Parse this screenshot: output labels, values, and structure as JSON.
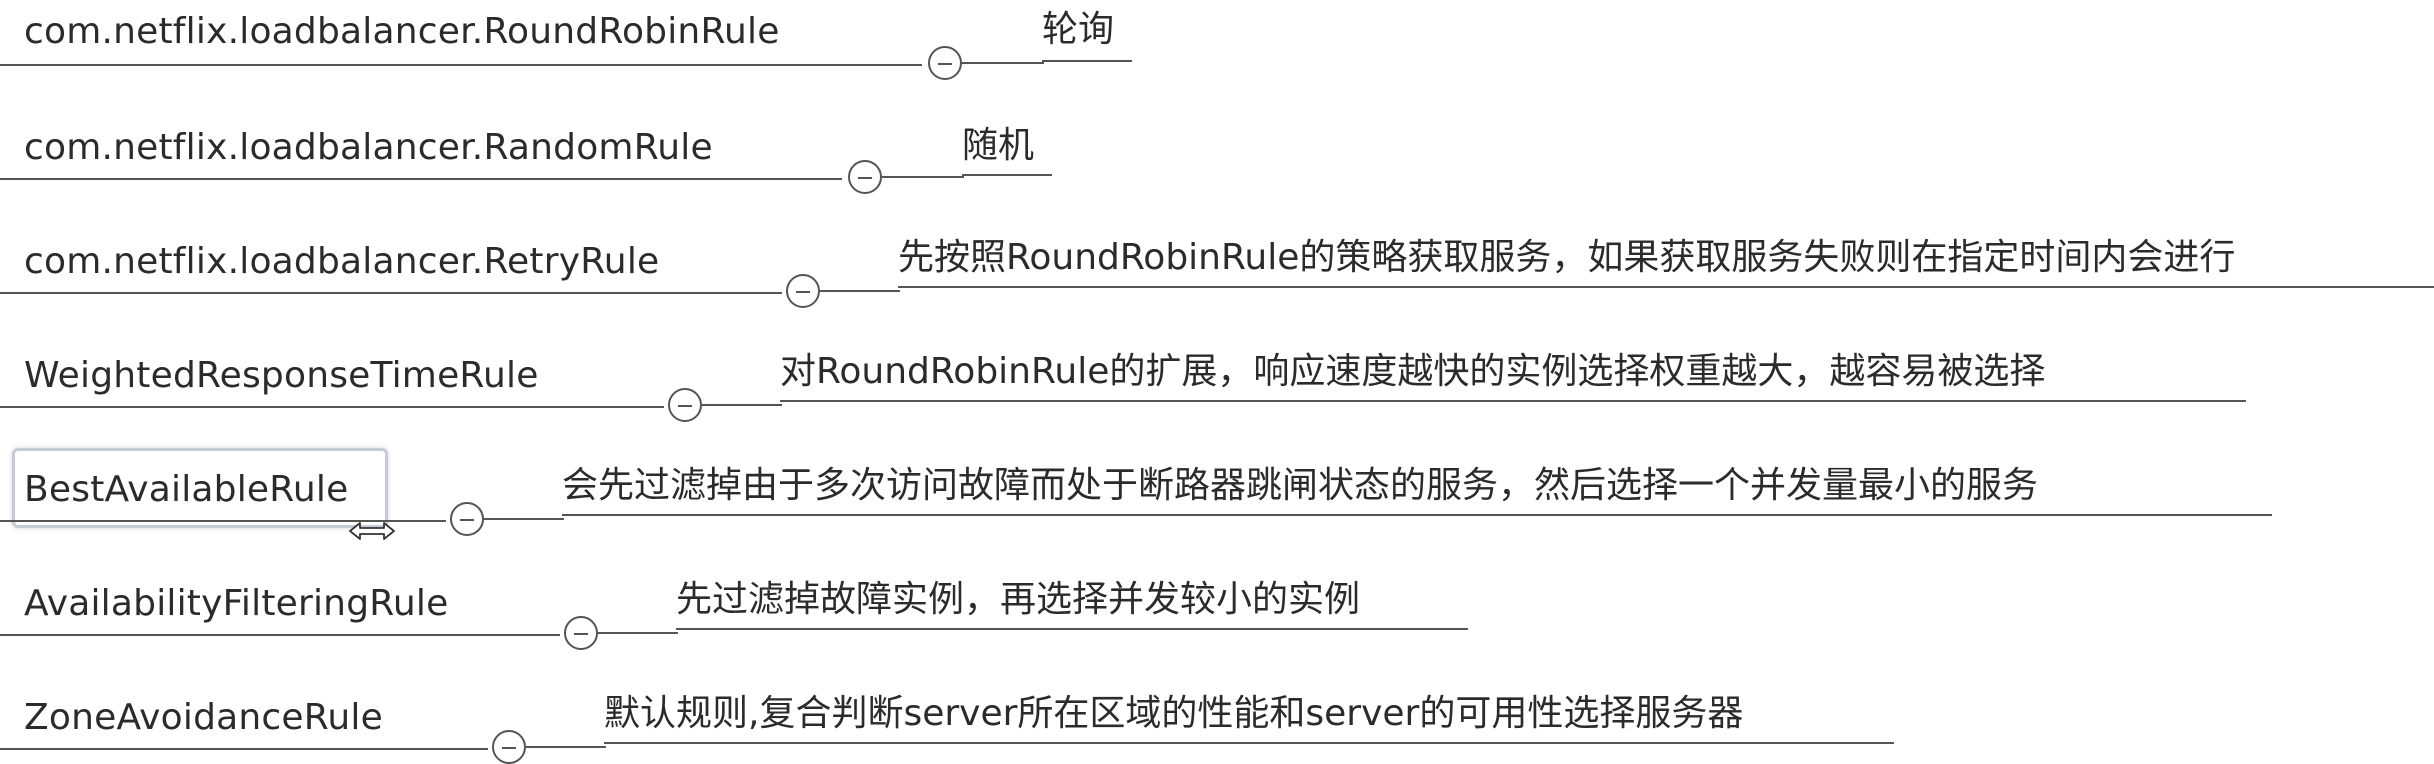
{
  "nodes": [
    {
      "name": "com.netflix.loadbalancer.RoundRobinRule",
      "description": "轮询",
      "selected": false
    },
    {
      "name": "com.netflix.loadbalancer.RandomRule",
      "description": "随机",
      "selected": false
    },
    {
      "name": "com.netflix.loadbalancer.RetryRule",
      "description": "先按照RoundRobinRule的策略获取服务，如果获取服务失败则在指定时间内会进行",
      "selected": false
    },
    {
      "name": "WeightedResponseTimeRule",
      "description": "对RoundRobinRule的扩展，响应速度越快的实例选择权重越大，越容易被选择",
      "selected": false
    },
    {
      "name": "BestAvailableRule",
      "description": "会先过滤掉由于多次访问故障而处于断路器跳闸状态的服务，然后选择一个并发量最小的服务",
      "selected": true
    },
    {
      "name": "AvailabilityFilteringRule",
      "description": "先过滤掉故障实例，再选择并发较小的实例",
      "selected": false
    },
    {
      "name": "ZoneAvoidanceRule",
      "description": "默认规则,复合判断server所在区域的性能和server的可用性选择服务器",
      "selected": false
    }
  ],
  "colors": {
    "line": "#555555",
    "text": "#2b2b2b",
    "selection_border": "#c6ccd6"
  },
  "icons": {
    "toggle": "collapse-minus-circle-icon",
    "cursor": "horizontal-resize-cursor-icon"
  }
}
